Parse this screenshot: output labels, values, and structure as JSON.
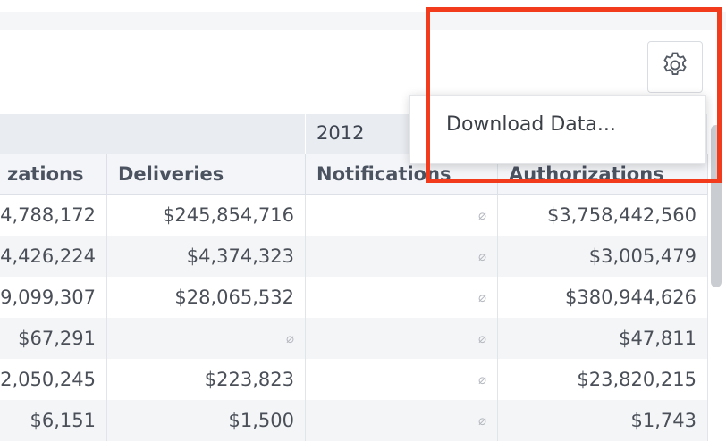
{
  "toolbar": {
    "settings_icon": "gear-icon"
  },
  "menu": {
    "items": [
      {
        "label": "Download Data..."
      }
    ]
  },
  "table": {
    "group_headers": [
      "",
      "2012"
    ],
    "columns": [
      "zations",
      "Deliveries",
      "Notifications",
      "Authorizations"
    ],
    "null_symbol": "⌀",
    "rows": [
      [
        "4,788,172",
        "$245,854,716",
        "⌀",
        "$3,758,442,560"
      ],
      [
        "4,426,224",
        "$4,374,323",
        "⌀",
        "$3,005,479"
      ],
      [
        "9,099,307",
        "$28,065,532",
        "⌀",
        "$380,944,626"
      ],
      [
        "$67,291",
        "⌀",
        "⌀",
        "$47,811"
      ],
      [
        "2,050,245",
        "$223,823",
        "⌀",
        "$23,820,215"
      ],
      [
        "$6,151",
        "$1,500",
        "⌀",
        "$1,743"
      ]
    ]
  },
  "colors": {
    "highlight": "#f23a1d",
    "header_bg": "#e9ecf1",
    "row_alt": "#f4f5f7"
  }
}
